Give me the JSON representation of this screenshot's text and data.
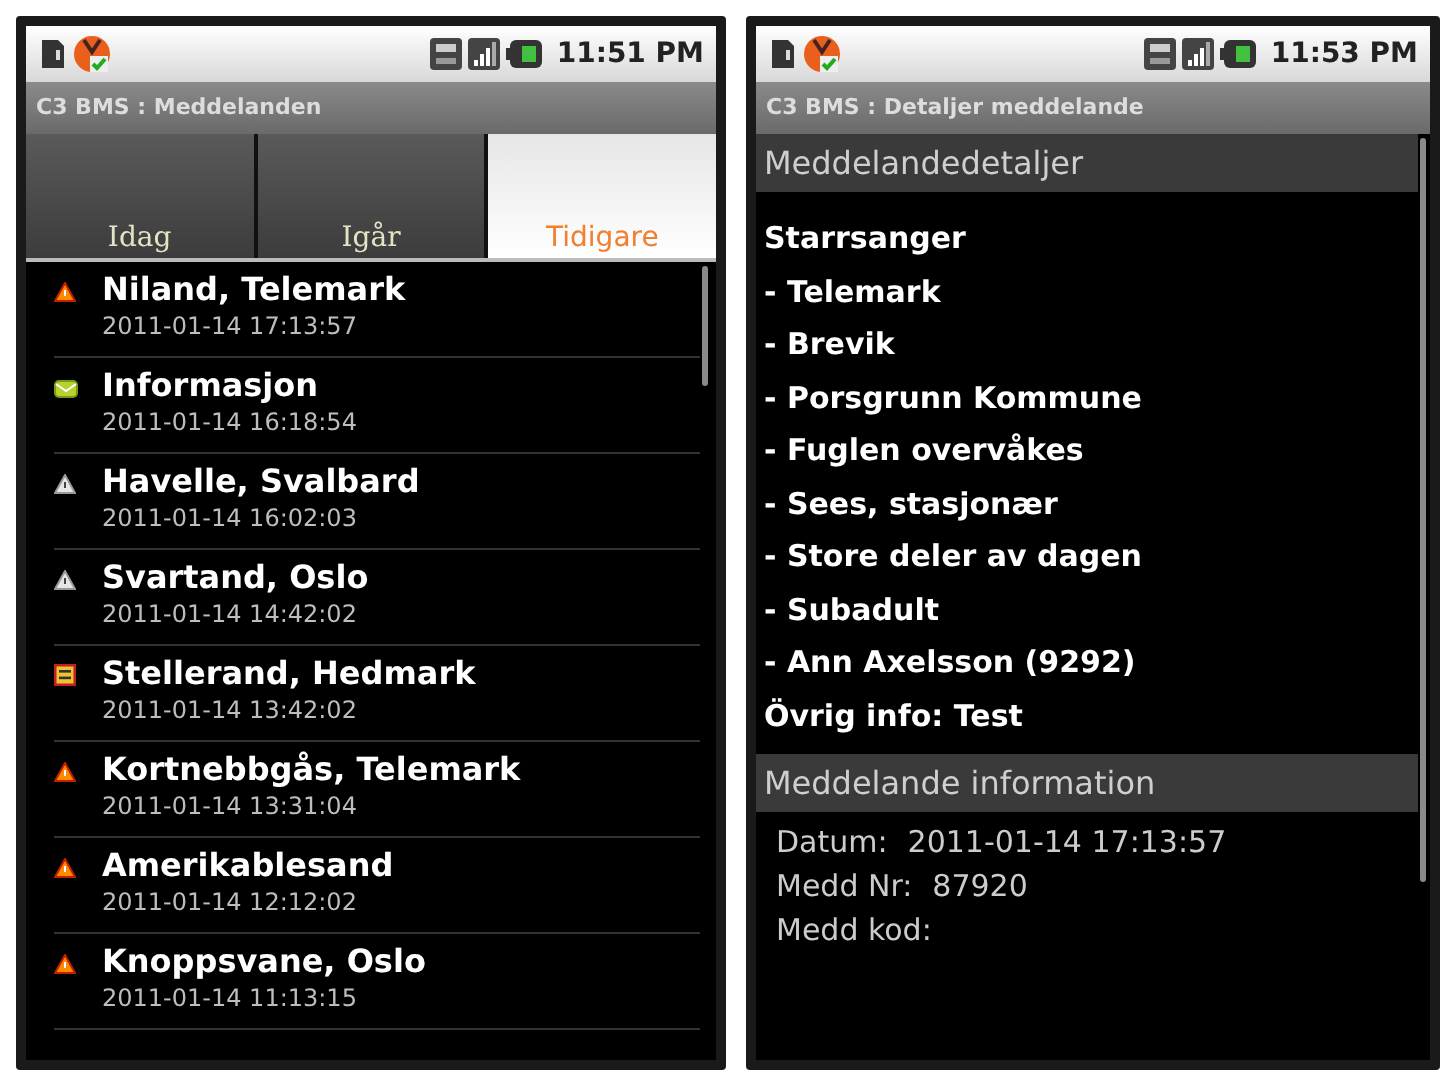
{
  "screens": [
    {
      "kind": "list",
      "status_bar": {
        "time": "11:51 PM"
      },
      "title": "C3 BMS : Meddelanden",
      "tabs": [
        {
          "label": "Idag",
          "selected": false
        },
        {
          "label": "Igår",
          "selected": false
        },
        {
          "label": "Tidigare",
          "selected": true
        }
      ],
      "messages": [
        {
          "kind": "alert",
          "title": "Niland, Telemark",
          "time": "2011-01-14 17:13:57"
        },
        {
          "kind": "mail",
          "title": "Informasjon",
          "time": "2011-01-14 16:18:54"
        },
        {
          "kind": "notice",
          "title": "Havelle, Svalbard",
          "time": "2011-01-14 16:02:03"
        },
        {
          "kind": "notice",
          "title": "Svartand, Oslo",
          "time": "2011-01-14 14:42:02"
        },
        {
          "kind": "report",
          "title": "Stellerand, Hedmark",
          "time": "2011-01-14 13:42:02"
        },
        {
          "kind": "alert",
          "title": "Kortnebbgås, Telemark",
          "time": "2011-01-14 13:31:04"
        },
        {
          "kind": "alert",
          "title": "Amerikablesand",
          "time": "2011-01-14 12:12:02"
        },
        {
          "kind": "alert",
          "title": "Knoppsvane, Oslo",
          "time": "2011-01-14 11:13:15"
        }
      ]
    },
    {
      "kind": "details",
      "status_bar": {
        "time": "11:53 PM"
      },
      "title": "C3 BMS : Detaljer meddelande",
      "details_header": "Meddelandedetaljer",
      "details": [
        "Starrsanger",
        "- Telemark",
        "- Brevik",
        "- Porsgrunn Kommune",
        "- Fuglen overvåkes",
        "- Sees, stasjonær",
        "- Store deler av dagen",
        "- Subadult",
        "- Ann Axelsson (9292)",
        "Övrig info: Test"
      ],
      "info_header": "Meddelande information",
      "info": [
        {
          "label": "Datum:",
          "value": "2011-01-14 17:13:57"
        },
        {
          "label": "Medd Nr:",
          "value": "87920"
        },
        {
          "label": "Medd kod:"
        }
      ]
    }
  ]
}
